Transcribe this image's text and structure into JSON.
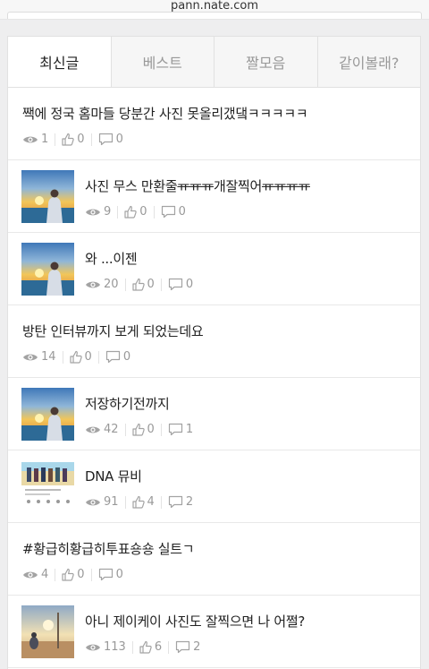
{
  "browser": {
    "url": "pann.nate.com"
  },
  "tabs": [
    {
      "label": "최신글",
      "active": true
    },
    {
      "label": "베스트",
      "active": false
    },
    {
      "label": "짤모음",
      "active": false
    },
    {
      "label": "같이볼래?",
      "active": false
    }
  ],
  "posts": [
    {
      "title": "짹에 정국 홈마들 당분간 사진 못올리갰댘ㅋㅋㅋㅋㅋ",
      "views": "1",
      "likes": "0",
      "comments": "0"
    },
    {
      "title_a": "사진 무스 만환줄",
      "title_b": "ㅠㅠㅠ",
      "title_c": "개잘찍어",
      "title_d": "ㅠㅠㅠㅠ",
      "views": "9",
      "likes": "0",
      "comments": "0"
    },
    {
      "title": "와 ...이젠",
      "views": "20",
      "likes": "0",
      "comments": "0"
    },
    {
      "title": "방탄 인터뷰까지 보게 되었는데요",
      "views": "14",
      "likes": "0",
      "comments": "0"
    },
    {
      "title": "저장하기전까지",
      "views": "42",
      "likes": "0",
      "comments": "1"
    },
    {
      "title": "DNA 뮤비",
      "views": "91",
      "likes": "4",
      "comments": "2"
    },
    {
      "title": "#황급히황급히투표숑숑 실트ㄱ",
      "views": "4",
      "likes": "0",
      "comments": "0"
    },
    {
      "title": "아니 제이케이 사진도 잘찍으면 나 어쩔?",
      "views": "113",
      "likes": "6",
      "comments": "2"
    }
  ],
  "colors": {
    "meta": "#999999",
    "active_tab_bg": "#ffffff",
    "inactive_tab_bg": "#f6f6f6"
  },
  "icons": {
    "views": "eye-icon",
    "likes": "thumbs-up-icon",
    "comments": "comment-icon"
  }
}
